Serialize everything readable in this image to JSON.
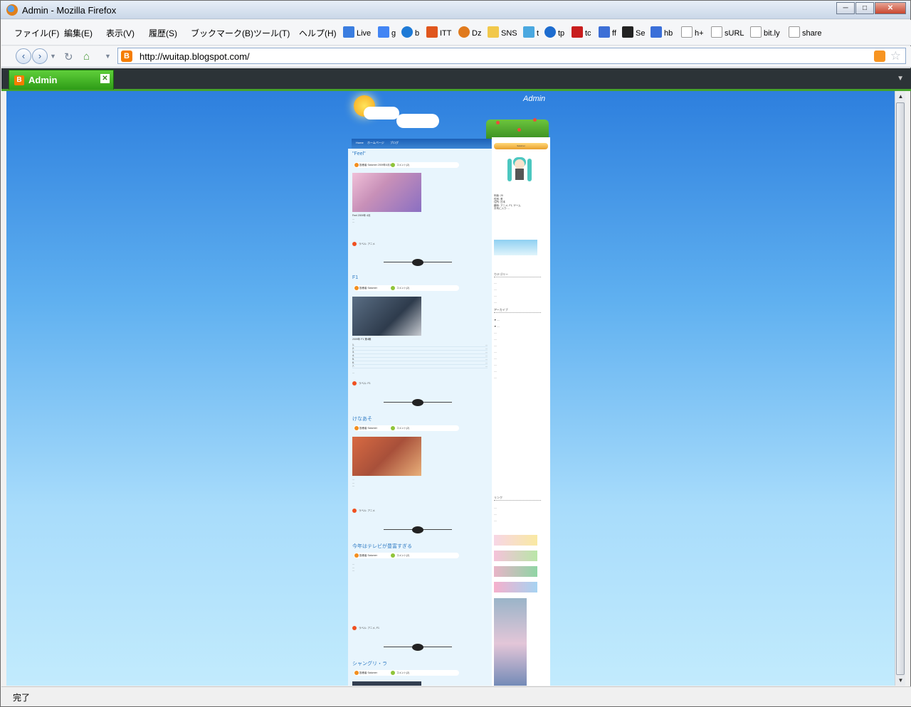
{
  "window": {
    "title": "Admin - Mozilla Firefox"
  },
  "menus": [
    "ファイル(F)",
    "編集(E)",
    "表示(V)",
    "履歴(S)",
    "ブックマーク(B)",
    "ツール(T)",
    "ヘルプ(H)"
  ],
  "bookmarks": [
    {
      "label": "Live",
      "icon": "windows-live-icon",
      "color": "#3a7de0"
    },
    {
      "label": "g",
      "icon": "google-icon",
      "color": "#4285f4"
    },
    {
      "label": "b",
      "icon": "bing-icon",
      "color": "#1e7ad6"
    },
    {
      "label": "ITT",
      "icon": "itt-icon",
      "color": "#e0561d"
    },
    {
      "label": "Dz",
      "icon": "dz-icon",
      "color": "#e07a1d"
    },
    {
      "label": "SNS",
      "icon": "folder-icon",
      "color": "#f1c84b"
    },
    {
      "label": "t",
      "icon": "twitter-icon",
      "color": "#4aa8e0"
    },
    {
      "label": "tp",
      "icon": "tp-icon",
      "color": "#1d6ccf"
    },
    {
      "label": "tc",
      "icon": "tc-icon",
      "color": "#c81d1d"
    },
    {
      "label": "ff",
      "icon": "friendfeed-icon",
      "color": "#3d6fd6"
    },
    {
      "label": "Se",
      "icon": "se-icon",
      "color": "#222222"
    },
    {
      "label": "hb",
      "icon": "hatena-icon",
      "color": "#3a6fd9"
    },
    {
      "label": "h+",
      "icon": "page-icon",
      "color": "#ffffff"
    },
    {
      "label": "sURL",
      "icon": "page-icon",
      "color": "#ffffff"
    },
    {
      "label": "bit.ly",
      "icon": "page-icon",
      "color": "#ffffff"
    },
    {
      "label": "share",
      "icon": "page-icon",
      "color": "#ffffff"
    }
  ],
  "navigation": {
    "url": "http://wuitap.blogspot.com/"
  },
  "tab": {
    "label": "Admin"
  },
  "status": {
    "text": "完了"
  },
  "blog": {
    "title": "Admin",
    "nav_links": [
      "Home",
      "ホームページ",
      "ブログ"
    ],
    "posts": [
      {
        "title": "\"Feel\"",
        "author": "投稿者 Saturner 2009年4月15日",
        "comments": "コメント(2)",
        "image_color": "#c890b8",
        "lines": [
          "Feel 2009年 4月",
          "...",
          "..."
        ],
        "footer": "ラベル: アニメ"
      },
      {
        "title": "F1",
        "author": "投稿者 Saturner",
        "comments": "コメント(2)",
        "image_color": "#3b4a5c",
        "lines": [
          "2009年 F1 第4戦",
          "..."
        ],
        "footer": "ラベル: F1"
      },
      {
        "title": "けなあそ",
        "author": "投稿者 Saturner",
        "comments": "コメント(2)",
        "image_color": "#a8503a",
        "lines": [
          "...",
          "...",
          "..."
        ],
        "footer": "ラベル: アニメ"
      },
      {
        "title": "今年はテレビが豊富すぎる",
        "author": "投稿者 Saturner",
        "comments": "コメント(2)",
        "image_color": "",
        "lines": [
          "...",
          "...",
          "..."
        ],
        "footer": "ラベル: アニメ, F1"
      },
      {
        "title": "シャングリ・ラ",
        "author": "投稿者 Saturner",
        "comments": "コメント(2)",
        "image_color": "#333f50",
        "lines": [],
        "footer": ""
      }
    ],
    "sidebar": {
      "banner": "Saturner",
      "profile": "年齢: 20\n性別: 男\n住所: 日本\n趣味: アニメ, F1, ゲーム\nお気に入り: ...",
      "categories_head": "カテゴリー",
      "archive_head": "アーカイブ",
      "links_head": "リンク"
    }
  }
}
